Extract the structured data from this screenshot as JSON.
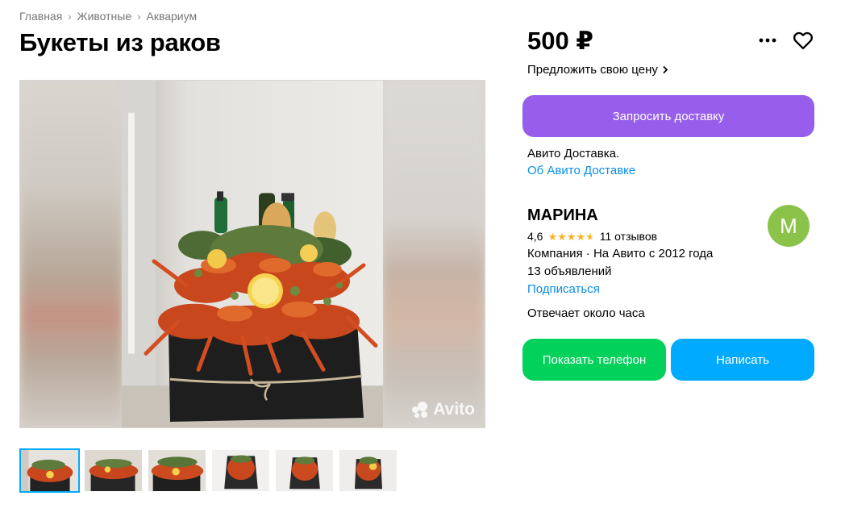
{
  "breadcrumb": {
    "items": [
      "Главная",
      "Животные",
      "Аквариум"
    ],
    "separator": "›"
  },
  "listing": {
    "title": "Букеты из раков",
    "price": "500 ₽",
    "offer_price_label": "Предложить свою цену"
  },
  "gallery": {
    "watermark": "Avito",
    "thumbnail_count": 6,
    "active_index": 0
  },
  "actions": {
    "more_icon": "more-dots-icon",
    "favorite_icon": "heart-icon"
  },
  "delivery": {
    "request_label": "Запросить доставку",
    "service_text": "Авито Доставка.",
    "about_link": "Об Авито Доставке"
  },
  "seller": {
    "name": "МАРИНА",
    "rating": "4,6",
    "rating_value": 4.6,
    "reviews": "11 отзывов",
    "info": "Компания · На Авито с 2012 года",
    "ads_count": "13 объявлений",
    "subscribe_label": "Подписаться",
    "avatar_letter": "М",
    "response_time": "Отвечает около часа"
  },
  "contact": {
    "phone_label": "Показать телефон",
    "write_label": "Написать"
  },
  "colors": {
    "delivery_button": "#965eeb",
    "phone_button": "#02d15c",
    "write_button": "#00aaff",
    "link": "#0a8ee6",
    "star": "#ffb021",
    "avatar": "#8bc34a"
  }
}
